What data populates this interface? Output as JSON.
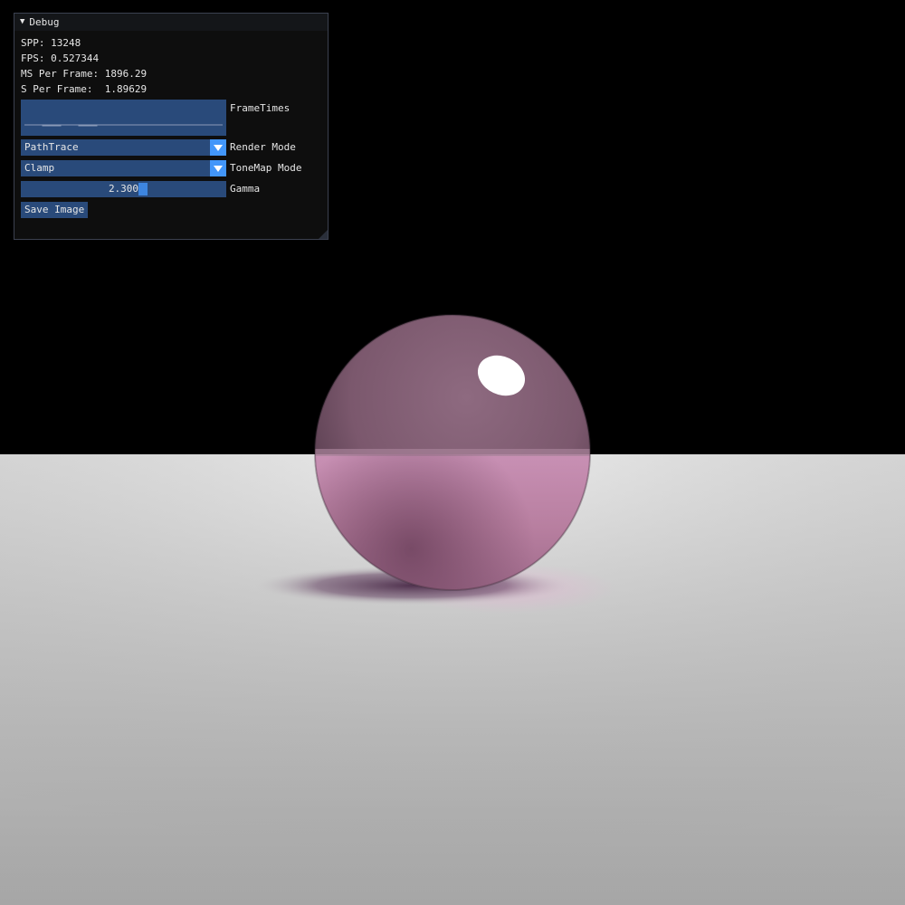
{
  "window": {
    "title": "Debug",
    "collapse_icon": "triangle-down-icon"
  },
  "stats": {
    "spp": "SPP: 13248",
    "fps": "FPS: 0.527344",
    "ms_per_frame": "MS Per Frame: 1896.29",
    "s_per_frame": "S Per Frame:  1.89629"
  },
  "frametimes": {
    "label": "FrameTimes"
  },
  "render_mode": {
    "label": "Render Mode",
    "value": "PathTrace"
  },
  "tonemap_mode": {
    "label": "ToneMap Mode",
    "value": "Clamp"
  },
  "gamma": {
    "label": "Gamma",
    "value": "2.300",
    "fraction": 0.6
  },
  "save_button": {
    "label": "Save Image"
  },
  "colors": {
    "widget_bg": "#294a7a",
    "accent": "#4296fa",
    "sphere_pink": "#b87fa0",
    "floor": "#c8c8c8"
  }
}
